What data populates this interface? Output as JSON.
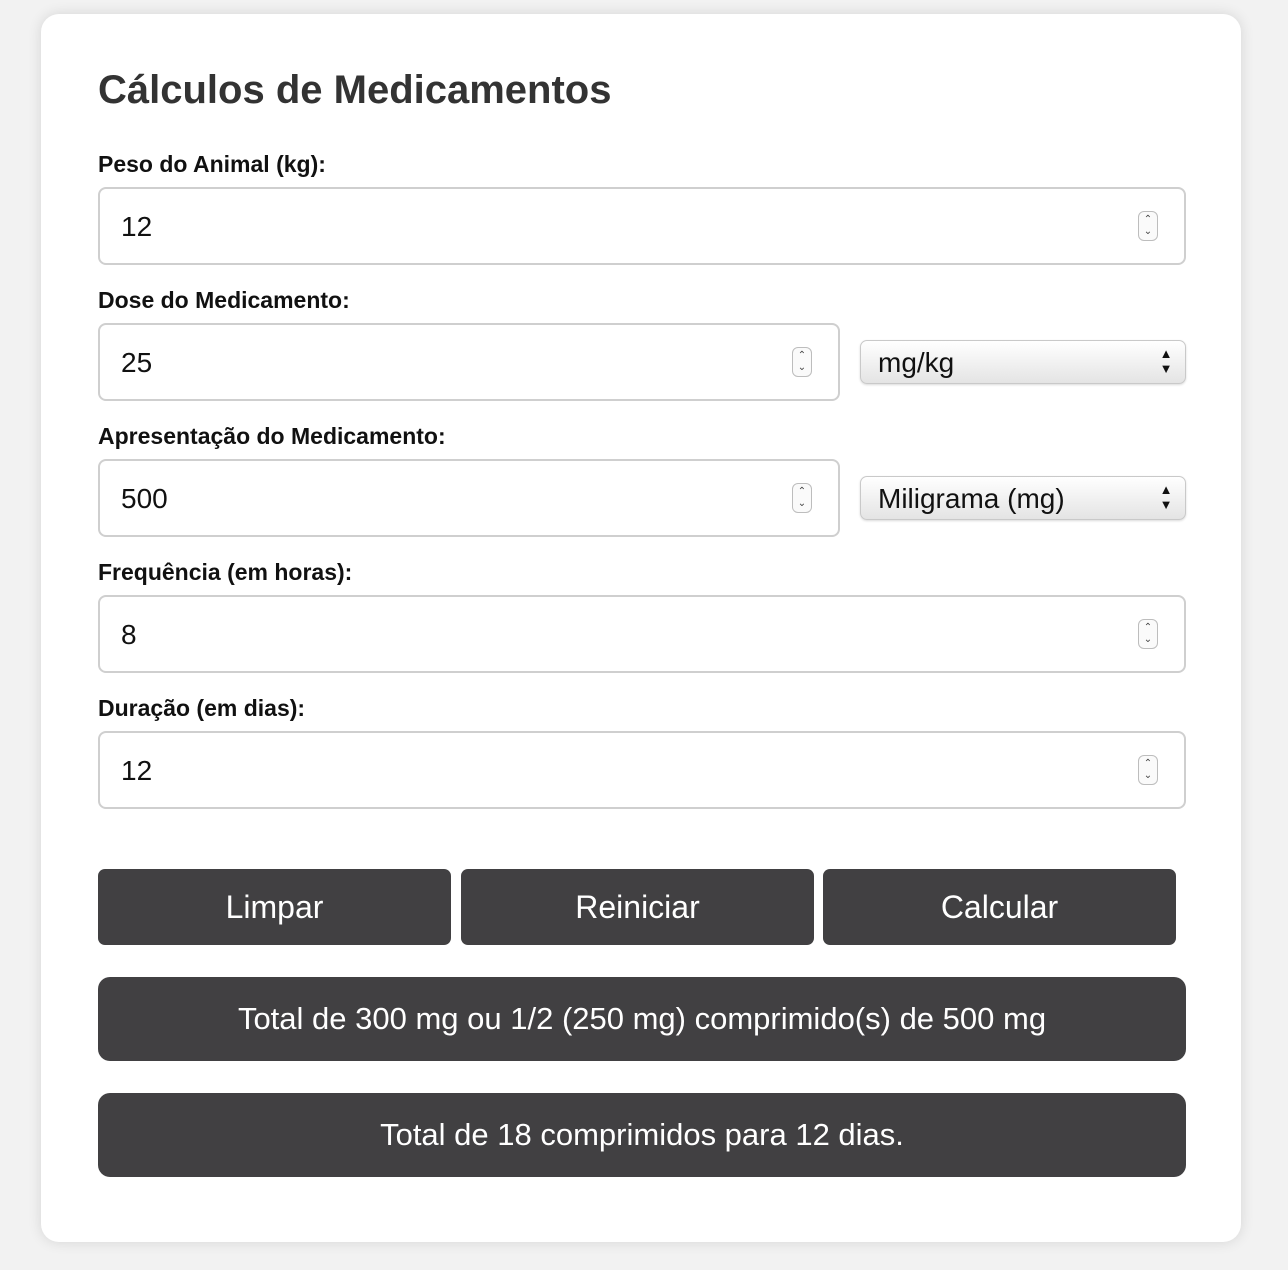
{
  "form": {
    "title": "Cálculos de Medicamentos",
    "weight": {
      "label": "Peso do Animal (kg):",
      "value": "12"
    },
    "dose": {
      "label": "Dose do Medicamento:",
      "value": "25",
      "unit": "mg/kg"
    },
    "presentation": {
      "label": "Apresentação do Medicamento:",
      "value": "500",
      "unit": "Miligrama (mg)"
    },
    "frequency": {
      "label": "Frequência (em horas):",
      "value": "8"
    },
    "duration": {
      "label": "Duração (em dias):",
      "value": "12"
    }
  },
  "actions": {
    "clear": "Limpar",
    "reset": "Reiniciar",
    "calculate": "Calcular"
  },
  "results": {
    "dose_result": "Total de 300 mg ou 1/2 (250 mg) comprimido(s) de 500 mg",
    "total_result": "Total de 18 comprimidos para 12 dias."
  },
  "colors": {
    "button_bg": "#414042",
    "page_bg": "#f2f2f2",
    "card_bg": "#ffffff"
  }
}
